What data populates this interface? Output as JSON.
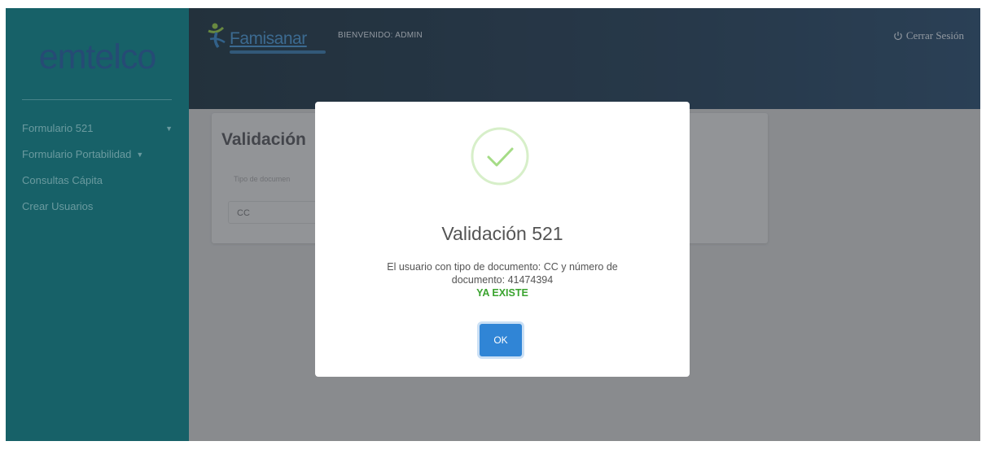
{
  "sidebar": {
    "brand": "emtelco",
    "items": [
      {
        "label": "Formulario 521",
        "has_caret": true
      },
      {
        "label": "Formulario Portabilidad",
        "has_caret": true
      },
      {
        "label": "Consultas Cápita",
        "has_caret": false
      },
      {
        "label": "Crear Usuarios",
        "has_caret": false
      }
    ]
  },
  "header": {
    "logo_text": "Famisanar",
    "welcome": "BIENVENIDO: ADMIN",
    "logout_label": "Cerrar Sesión"
  },
  "main": {
    "card_title": "Validación",
    "field_label": "Tipo de documen",
    "document_type_value": "CC"
  },
  "modal": {
    "title": "Validación 521",
    "message_line1": "El usuario con tipo de documento: CC y número de",
    "message_line2": "documento: 41474394",
    "status": "YA EXISTE",
    "ok_label": "OK"
  },
  "colors": {
    "sidebar": "#0b6c74",
    "header": "#16344f",
    "success": "#a5dc86",
    "status_text": "#3aa32f",
    "primary_button": "#3085d6"
  },
  "icons": [
    "caret-down-icon",
    "power-icon",
    "success-check-icon",
    "famisanar-logo-icon"
  ]
}
